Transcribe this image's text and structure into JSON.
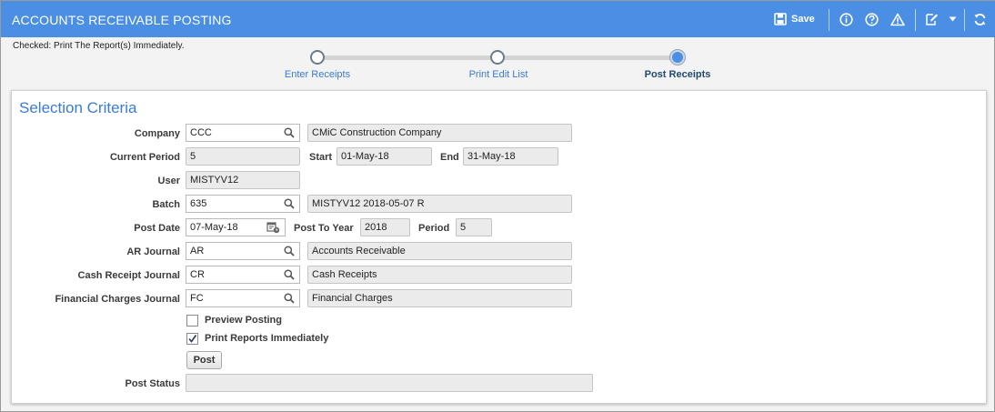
{
  "header": {
    "title": "ACCOUNTS RECEIVABLE POSTING",
    "save_label": "Save",
    "icons": [
      "save-icon",
      "info-icon",
      "help-icon",
      "warning-icon",
      "edit-icon",
      "chevron-down-icon",
      "refresh-icon"
    ]
  },
  "message": "Checked: Print The Report(s) Immediately.",
  "steps": [
    {
      "label": "Enter Receipts",
      "state": "done"
    },
    {
      "label": "Print Edit List",
      "state": "done"
    },
    {
      "label": "Post Receipts",
      "state": "current"
    }
  ],
  "section_title": "Selection Criteria",
  "form": {
    "company": {
      "label": "Company",
      "value": "CCC",
      "description": "CMiC Construction Company"
    },
    "current_period": {
      "label": "Current Period",
      "value": "5",
      "start_label": "Start",
      "start": "01-May-18",
      "end_label": "End",
      "end": "31-May-18"
    },
    "user": {
      "label": "User",
      "value": "MISTYV12"
    },
    "batch": {
      "label": "Batch",
      "value": "635",
      "description": "MISTYV12 2018-05-07 R"
    },
    "post_date": {
      "label": "Post Date",
      "value": "07-May-18",
      "post_to_year_label": "Post To Year",
      "post_to_year": "2018",
      "period_label": "Period",
      "period": "5"
    },
    "ar_journal": {
      "label": "AR Journal",
      "value": "AR",
      "description": "Accounts Receivable"
    },
    "cash_receipt_journal": {
      "label": "Cash Receipt Journal",
      "value": "CR",
      "description": "Cash Receipts"
    },
    "financial_charges_journal": {
      "label": "Financial Charges Journal",
      "value": "FC",
      "description": "Financial Charges"
    },
    "preview_posting": {
      "label": "Preview Posting",
      "checked": false
    },
    "print_reports": {
      "label": "Print Reports Immediately",
      "checked": true
    },
    "post_button": "Post",
    "post_status": {
      "label": "Post Status",
      "value": ""
    }
  },
  "colors": {
    "header_bg": "#4a8fe3",
    "accent": "#3a7bd5",
    "step_current": "#4a8fe3"
  }
}
